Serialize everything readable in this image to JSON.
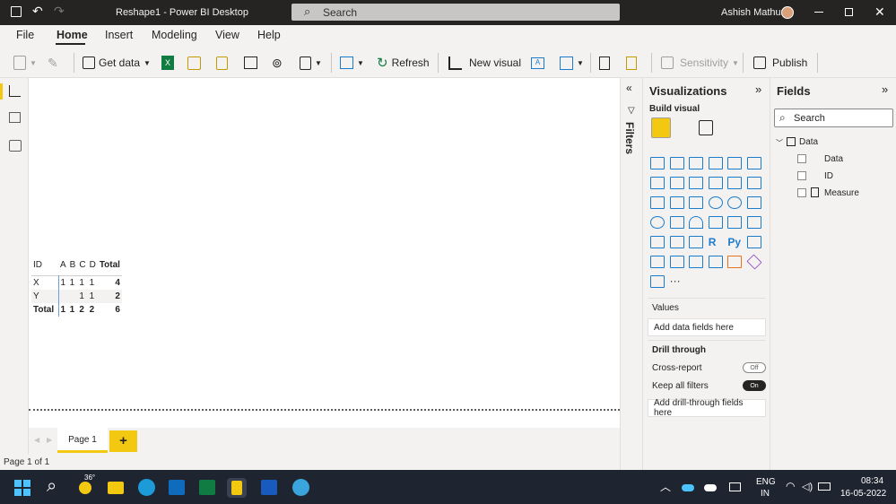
{
  "window": {
    "title": "Reshape1 - Power BI Desktop",
    "search": "Search",
    "user": "Ashish Mathur"
  },
  "menu": [
    "File",
    "Home",
    "Insert",
    "Modeling",
    "View",
    "Help"
  ],
  "ribbon": {
    "get_data": "Get data",
    "refresh": "Refresh",
    "new_visual": "New visual",
    "sensitivity": "Sensitivity",
    "publish": "Publish"
  },
  "matrix": {
    "headers": [
      "ID",
      "A",
      "B",
      "C",
      "D",
      "Total"
    ],
    "rows": [
      [
        "X",
        "1",
        "1",
        "1",
        "1",
        "4"
      ],
      [
        "Y",
        "",
        "",
        "1",
        "1",
        "2"
      ]
    ],
    "total": [
      "Total",
      "1",
      "1",
      "2",
      "2",
      "6"
    ]
  },
  "pages": {
    "tab": "Page 1",
    "add": "+"
  },
  "status": "Page 1 of 1",
  "filters": {
    "label": "Filters"
  },
  "viz": {
    "title": "Visualizations",
    "build": "Build visual",
    "values": "Values",
    "values_placeholder": "Add data fields here",
    "drill": "Drill through",
    "cross_report": "Cross-report",
    "cross_state": "Off",
    "keep_filters": "Keep all filters",
    "keep_state": "On",
    "drill_placeholder": "Add drill-through fields here",
    "more": "···"
  },
  "fields": {
    "title": "Fields",
    "search": "Search",
    "table": "Data",
    "items": [
      "Data",
      "ID",
      "Measure"
    ]
  },
  "taskbar": {
    "temp": "36°",
    "lang1": "ENG",
    "lang2": "IN",
    "time": "08:34",
    "date": "16-05-2022"
  }
}
